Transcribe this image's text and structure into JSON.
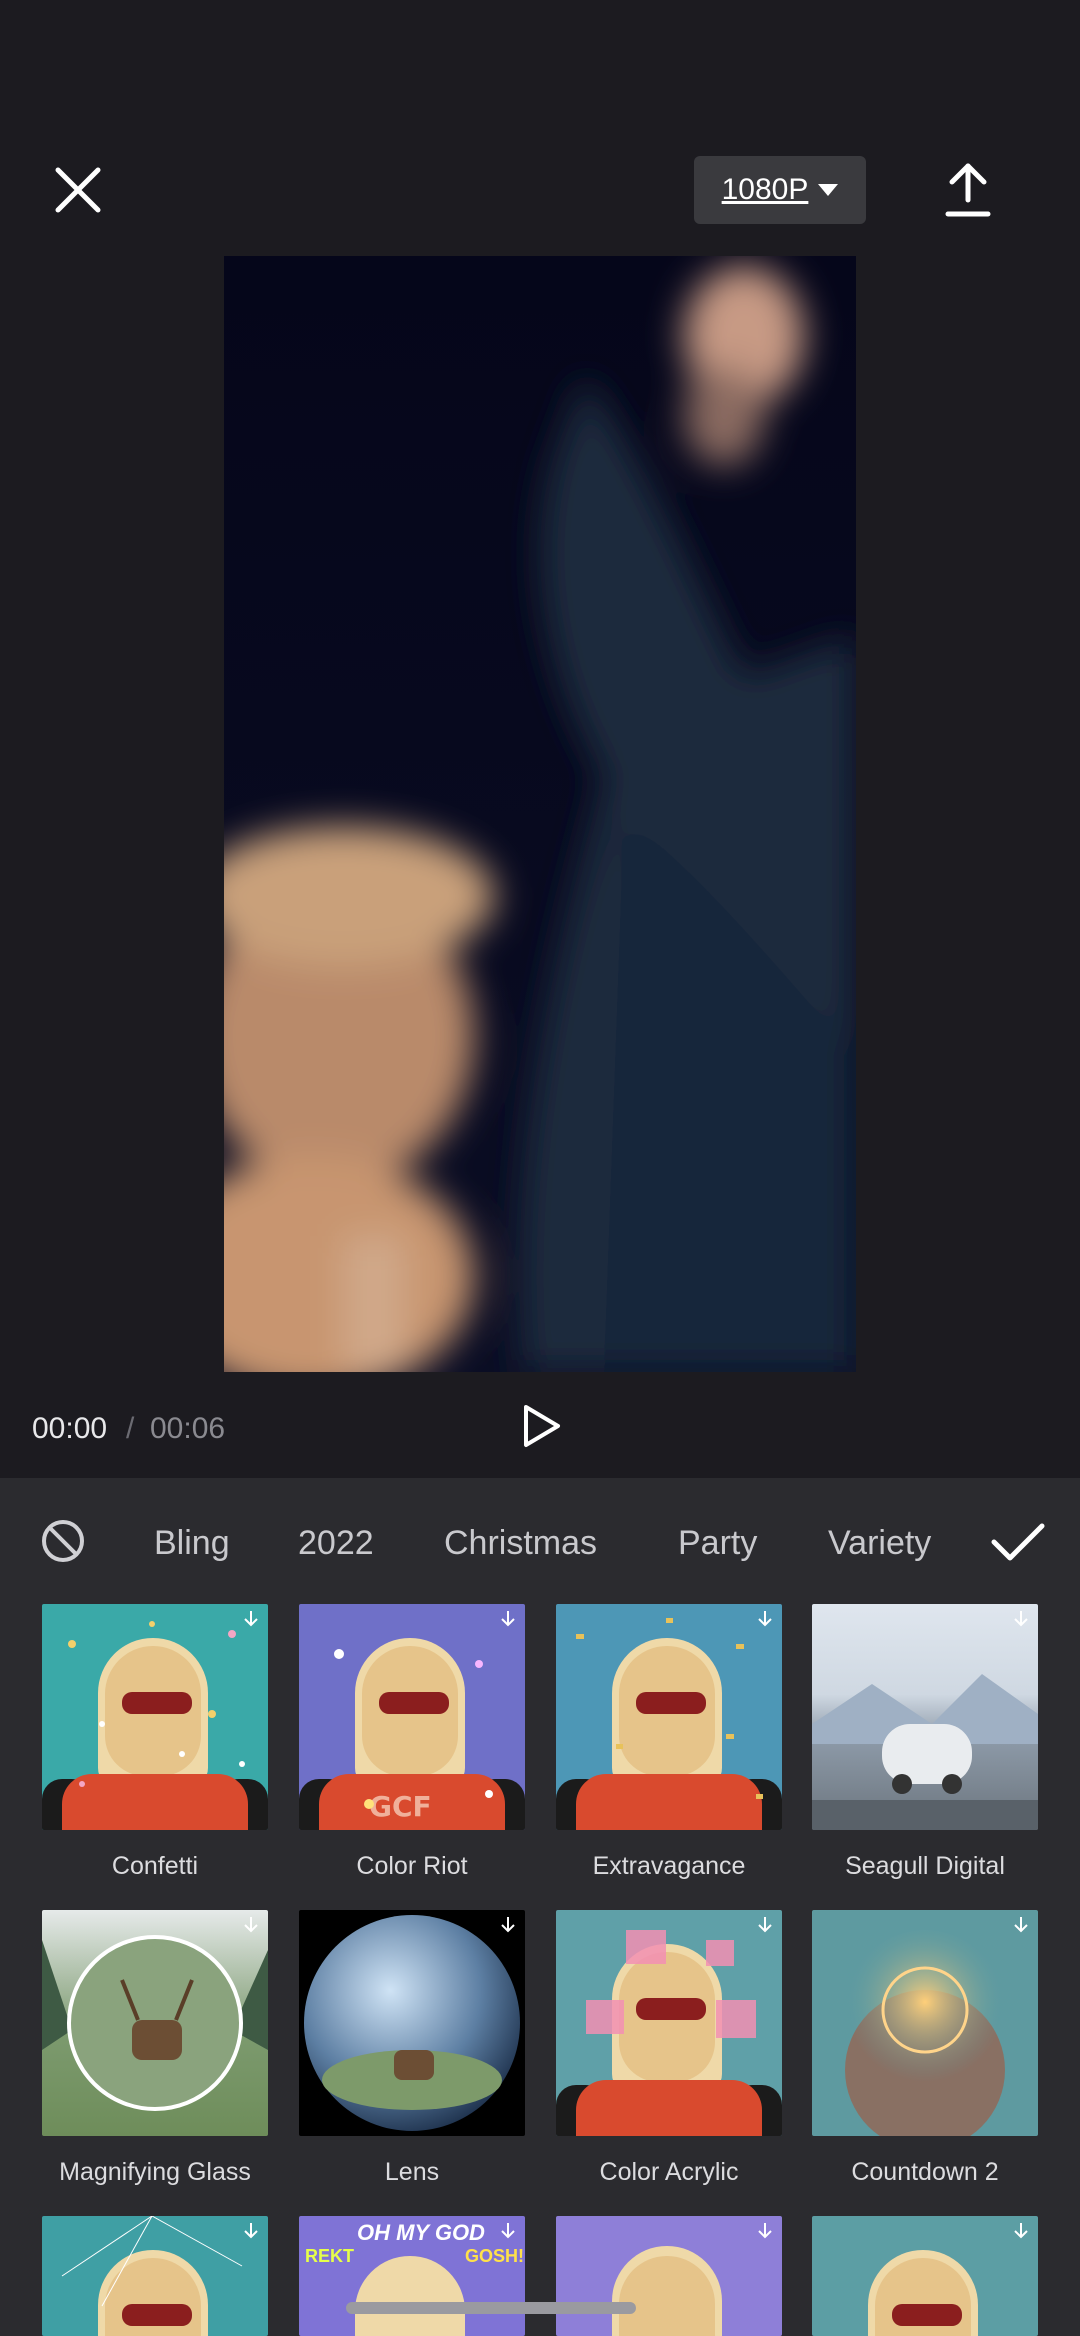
{
  "header": {
    "resolution": "1080P",
    "close_icon": "close-icon",
    "export_icon": "upload-icon"
  },
  "player": {
    "current_time": "00:00",
    "separator": "/",
    "duration": "00:06",
    "play_icon": "play-icon"
  },
  "effects_panel": {
    "none_icon": "no-effect-icon",
    "categories": [
      "Bling",
      "2022",
      "Christmas",
      "Party",
      "Variety"
    ],
    "confirm_icon": "checkmark-icon",
    "items": [
      {
        "label": "Confetti"
      },
      {
        "label": "Color Riot"
      },
      {
        "label": "Extravagance"
      },
      {
        "label": "Seagull Digital"
      },
      {
        "label": "Magnifying Glass"
      },
      {
        "label": "Lens"
      },
      {
        "label": "Color Acrylic"
      },
      {
        "label": "Countdown 2"
      }
    ],
    "third_row_texts": {
      "oh_my_god": "OH MY GOD",
      "rekt": "REKT",
      "gosh": "GOSH!"
    }
  },
  "colors": {
    "background": "#1c1b20",
    "panel": "#2b2b2f",
    "resolution_button": "#3a3a3e"
  }
}
